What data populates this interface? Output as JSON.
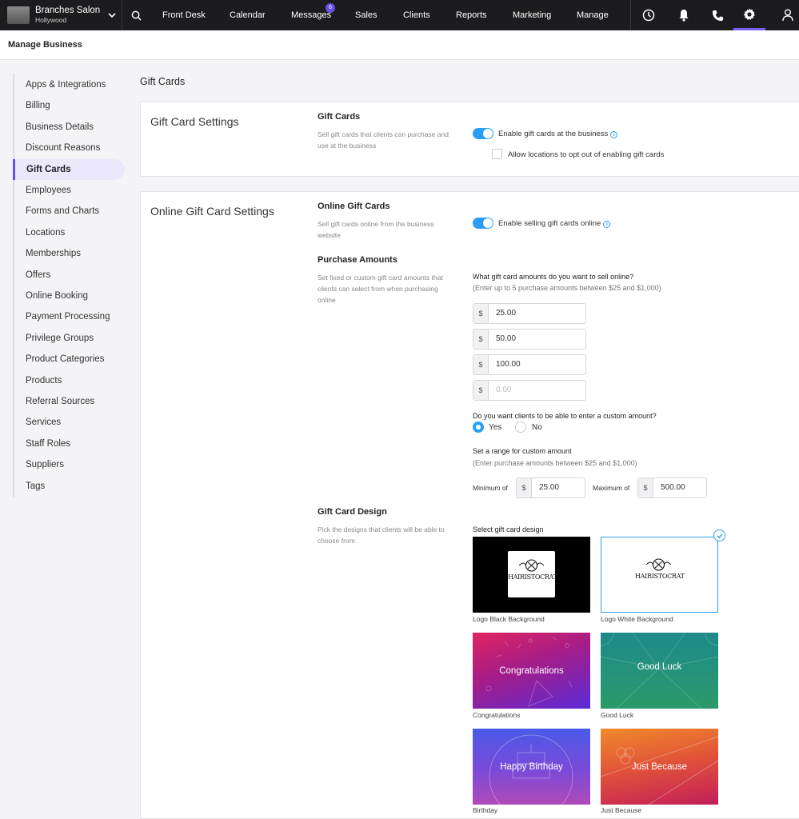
{
  "topnav": {
    "brand_name": "Branches Salon",
    "brand_location": "Hollywood",
    "items": [
      "Front Desk",
      "Calendar",
      "Messages",
      "Sales",
      "Clients",
      "Reports",
      "Marketing",
      "Manage"
    ],
    "messages_badge": "6",
    "right_icons": [
      "clock-icon",
      "bell-icon",
      "phone-icon",
      "gear-icon",
      "user-icon"
    ],
    "active_color": "#7b5cff"
  },
  "subheader": {
    "title": "Manage Business"
  },
  "sidebar": {
    "items": [
      "Apps & Integrations",
      "Billing",
      "Business Details",
      "Discount Reasons",
      "Gift Cards",
      "Employees",
      "Forms and Charts",
      "Locations",
      "Memberships",
      "Offers",
      "Online Booking",
      "Payment Processing",
      "Privilege Groups",
      "Product Categories",
      "Products",
      "Referral Sources",
      "Services",
      "Staff Roles",
      "Suppliers",
      "Tags"
    ],
    "active": "Gift Cards"
  },
  "page_title": "Gift Cards",
  "gift_card_settings": {
    "title": "Gift Card Settings",
    "section_title": "Gift Cards",
    "section_desc": "Sell gift cards that clients can purchase and use at the business",
    "enable_label": "Enable gift cards at the business",
    "enable_on": true,
    "opt_out_label": "Allow locations to opt out of enabling gift cards",
    "opt_out_checked": false
  },
  "online_settings": {
    "title": "Online Gift Card Settings",
    "online_title": "Online Gift Cards",
    "online_desc": "Sell gift cards online from the business website",
    "enable_online_label": "Enable selling gift cards online",
    "enable_online_on": true,
    "purchase_title": "Purchase Amounts",
    "purchase_desc": "Set fixed or custom gift card amounts that clients can select from when purchasing online",
    "amounts_question": "What gift card amounts do you want to sell online?",
    "amounts_hint": "(Enter up to 5 purchase amounts between $25 and $1,000)",
    "currency": "$",
    "amounts": [
      "25.00",
      "50.00",
      "100.00"
    ],
    "amount_placeholder": "0.00",
    "custom_question": "Do you want clients to be able to enter a custom amount?",
    "yes_label": "Yes",
    "no_label": "No",
    "custom_selected": "Yes",
    "range_title": "Set a range for custom amount",
    "range_hint": "(Enter purchase amounts between $25 and $1,000)",
    "min_label": "Minimum of",
    "min_value": "25.00",
    "max_label": "Maximum of",
    "max_value": "500.00",
    "design_title": "Gift Card Design",
    "design_desc": "Pick the designs that clients will be able to choose from",
    "select_label": "Select gift card design",
    "logo_text": "HAIRISTOCRAT",
    "designs": [
      {
        "caption": "Logo Black Background",
        "text": ""
      },
      {
        "caption": "Logo White Background",
        "text": "",
        "selected": true
      },
      {
        "caption": "Congratulations",
        "text": "Congratulations"
      },
      {
        "caption": "Good Luck",
        "text": "Good Luck"
      },
      {
        "caption": "Birthday",
        "text": "Happy Birthday"
      },
      {
        "caption": "Just Because",
        "text": "Just Because"
      }
    ],
    "toggle_color": "#2a9ef6"
  }
}
